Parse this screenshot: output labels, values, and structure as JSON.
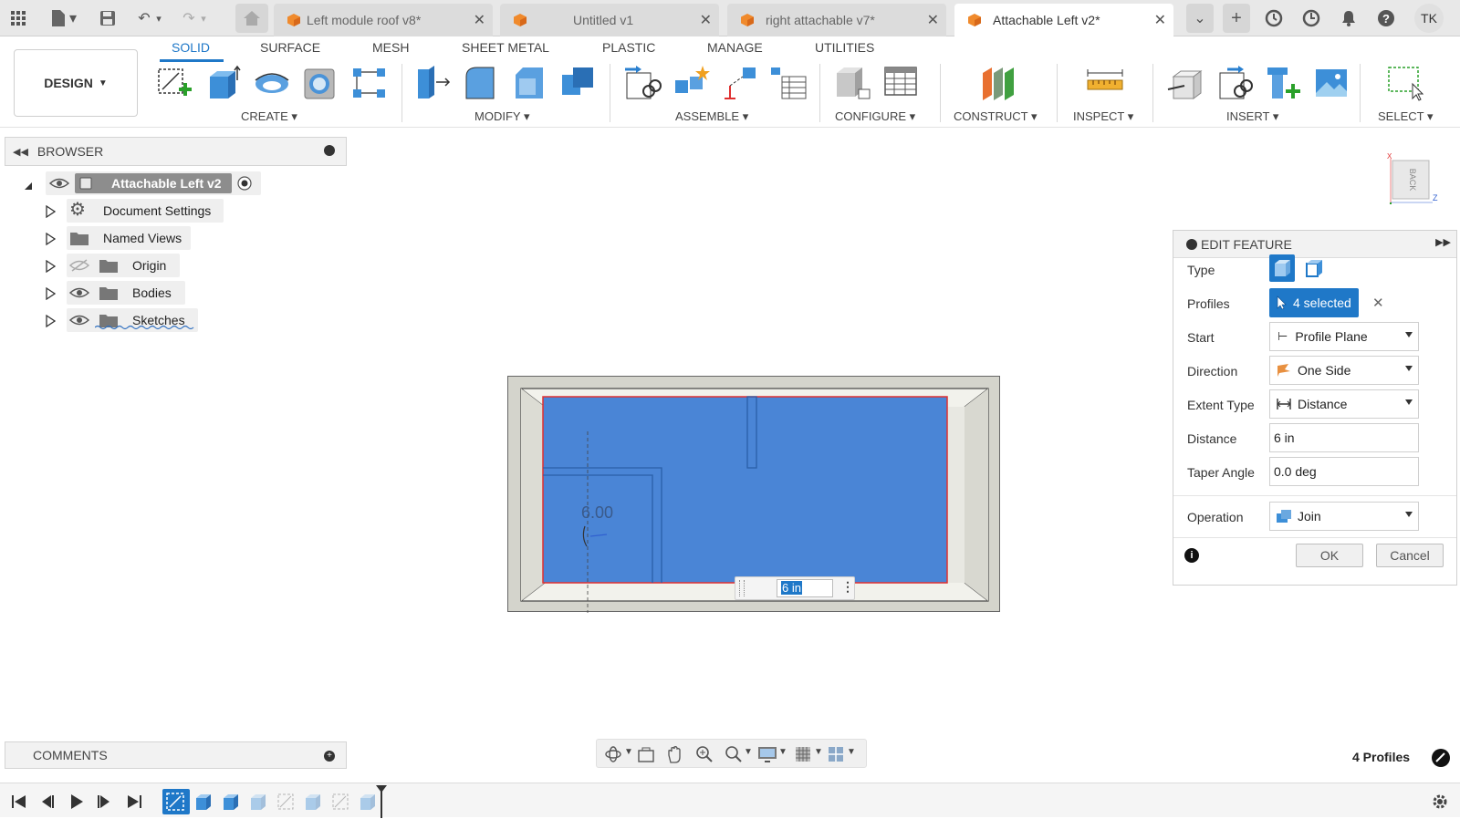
{
  "tabbar": {
    "tabs": [
      {
        "label": "Left module roof v8*",
        "active": false
      },
      {
        "label": "Untitled v1",
        "active": false
      },
      {
        "label": "right attachable v7*",
        "active": false
      },
      {
        "label": "Attachable Left v2*",
        "active": true
      }
    ],
    "user_initials": "TK"
  },
  "toolbar": {
    "workspace_tabs": [
      "SOLID",
      "SURFACE",
      "MESH",
      "SHEET METAL",
      "PLASTIC",
      "MANAGE",
      "UTILITIES"
    ],
    "active_workspace_tab": "SOLID",
    "design_label": "DESIGN",
    "groups": [
      "CREATE",
      "MODIFY",
      "ASSEMBLE",
      "CONFIGURE",
      "CONSTRUCT",
      "INSPECT",
      "INSERT",
      "SELECT"
    ]
  },
  "browser": {
    "title": "BROWSER",
    "root": "Attachable Left v2",
    "items": [
      "Document Settings",
      "Named Views",
      "Origin",
      "Bodies",
      "Sketches"
    ]
  },
  "viewport": {
    "dimension_label": "6.00",
    "distance_input": "6 in",
    "viewcube_face": "BACK",
    "axis_x": "X",
    "axis_z": "Z",
    "status": "4 Profiles"
  },
  "edit_feature": {
    "title": "EDIT FEATURE",
    "type_label": "Type",
    "profiles_label": "Profiles",
    "profiles_value": "4 selected",
    "start_label": "Start",
    "start_value": "Profile Plane",
    "direction_label": "Direction",
    "direction_value": "One Side",
    "extent_label": "Extent Type",
    "extent_value": "Distance",
    "distance_label": "Distance",
    "distance_value": "6 in",
    "taper_label": "Taper Angle",
    "taper_value": "0.0 deg",
    "operation_label": "Operation",
    "operation_value": "Join",
    "ok_label": "OK",
    "cancel_label": "Cancel"
  },
  "comments": {
    "title": "COMMENTS"
  },
  "colors": {
    "accent": "#1f78c8",
    "profile_fill": "#4a85d6",
    "profile_edge": "#e03030"
  }
}
